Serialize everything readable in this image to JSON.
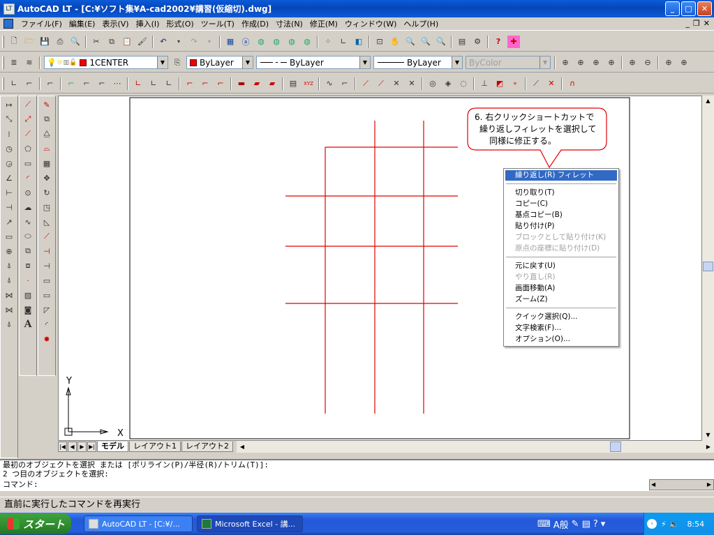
{
  "window": {
    "app_icon": "LT",
    "title": "AutoCAD LT - [C:¥ソフト集¥A-cad2002¥講習(仮縮切).dwg]"
  },
  "menubar": {
    "items": [
      "ファイル(F)",
      "編集(E)",
      "表示(V)",
      "挿入(I)",
      "形式(O)",
      "ツール(T)",
      "作成(D)",
      "寸法(N)",
      "修正(M)",
      "ウィンドウ(W)",
      "ヘルプ(H)"
    ]
  },
  "toolbar_row3": {
    "layer": "1CENTER",
    "color": "ByLayer",
    "linetype": "ByLayer",
    "lineweight": "ByLayer",
    "plotstyle": "ByColor"
  },
  "callout": {
    "lines": [
      "6. 右クリックショートカットで",
      "繰り返しフィレットを選択して",
      "同様に修正する。"
    ]
  },
  "context_menu": {
    "items": [
      {
        "label": "繰り返し(R) フィレット",
        "highlighted": true,
        "disabled": false
      },
      {
        "sep": true
      },
      {
        "label": "切り取り(T)",
        "disabled": false
      },
      {
        "label": "コピー(C)",
        "disabled": false
      },
      {
        "label": "基点コピー(B)",
        "disabled": false
      },
      {
        "label": "貼り付け(P)",
        "disabled": false
      },
      {
        "label": "ブロックとして貼り付け(K)",
        "disabled": true
      },
      {
        "label": "原点の座標に貼り付け(D)",
        "disabled": true
      },
      {
        "sep": true
      },
      {
        "label": "元に戻す(U)",
        "disabled": false
      },
      {
        "label": "やり直し(R)",
        "disabled": true
      },
      {
        "label": "画面移動(A)",
        "disabled": false
      },
      {
        "label": "ズーム(Z)",
        "disabled": false
      },
      {
        "sep": true
      },
      {
        "label": "クイック選択(Q)...",
        "disabled": false
      },
      {
        "label": "文字検索(F)...",
        "disabled": false
      },
      {
        "label": "オプション(O)...",
        "disabled": false
      }
    ]
  },
  "ucs": {
    "x": "X",
    "y": "Y"
  },
  "layout_tabs": [
    "モデル",
    "レイアウト1",
    "レイアウト2"
  ],
  "command": {
    "line1": "最初のオブジェクトを選択 または [ポリライン(P)/半径(R)/トリム(T)]:",
    "line2": "2 つ目のオブジェクトを選択:",
    "prompt": "コマンド:"
  },
  "status": {
    "text": "直前に実行したコマンドを再実行"
  },
  "taskbar": {
    "start": "スタート",
    "app1": "AutoCAD LT - [C:¥/...",
    "app2": "Microsoft Excel - 講...",
    "ime": "A般",
    "clock": "8:54"
  },
  "colors": {
    "drawing_line": "#e00000",
    "menu_highlight": "#316ac5",
    "titlebar": "#0a5bd8"
  }
}
